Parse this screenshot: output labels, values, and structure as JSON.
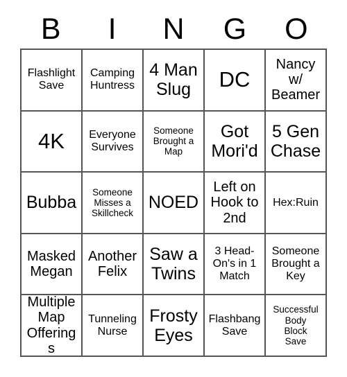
{
  "card": {
    "header_letters": [
      "B",
      "I",
      "N",
      "G",
      "O"
    ],
    "grid_size": 5,
    "colors": {
      "background": "#ffffff",
      "text": "#000000",
      "border": "#555555"
    },
    "rows": [
      [
        {
          "text": "Flashlight\nSave",
          "size": "sm"
        },
        {
          "text": "Camping\nHuntress",
          "size": "sm"
        },
        {
          "text": "4 Man\nSlug",
          "size": "lg"
        },
        {
          "text": "DC",
          "size": "xl"
        },
        {
          "text": "Nancy\nw/\nBeamer",
          "size": "md"
        }
      ],
      [
        {
          "text": "4K",
          "size": "xl"
        },
        {
          "text": "Everyone\nSurvives",
          "size": "sm"
        },
        {
          "text": "Someone\nBrought a\nMap",
          "size": "xs"
        },
        {
          "text": "Got\nMori'd",
          "size": "lg"
        },
        {
          "text": "5 Gen\nChase",
          "size": "lg"
        }
      ],
      [
        {
          "text": "Bubba",
          "size": "lg"
        },
        {
          "text": "Someone\nMisses a\nSkillcheck",
          "size": "xs"
        },
        {
          "text": "NOED",
          "size": "lg"
        },
        {
          "text": "Left on\nHook to\n2nd",
          "size": "md"
        },
        {
          "text": "Hex:Ruin",
          "size": "sm"
        }
      ],
      [
        {
          "text": "Masked\nMegan",
          "size": "md"
        },
        {
          "text": "Another\nFelix",
          "size": "md"
        },
        {
          "text": "Saw a\nTwins",
          "size": "lg"
        },
        {
          "text": "3 Head-\nOn's in 1\nMatch",
          "size": "sm"
        },
        {
          "text": "Someone\nBrought a\nKey",
          "size": "sm"
        }
      ],
      [
        {
          "text": "Multiple\nMap\nOfferings",
          "size": "md"
        },
        {
          "text": "Tunneling\nNurse",
          "size": "sm"
        },
        {
          "text": "Frosty\nEyes",
          "size": "lg"
        },
        {
          "text": "Flashbang\nSave",
          "size": "sm"
        },
        {
          "text": "Successful\nBody\nBlock\nSave",
          "size": "xs"
        }
      ]
    ]
  }
}
